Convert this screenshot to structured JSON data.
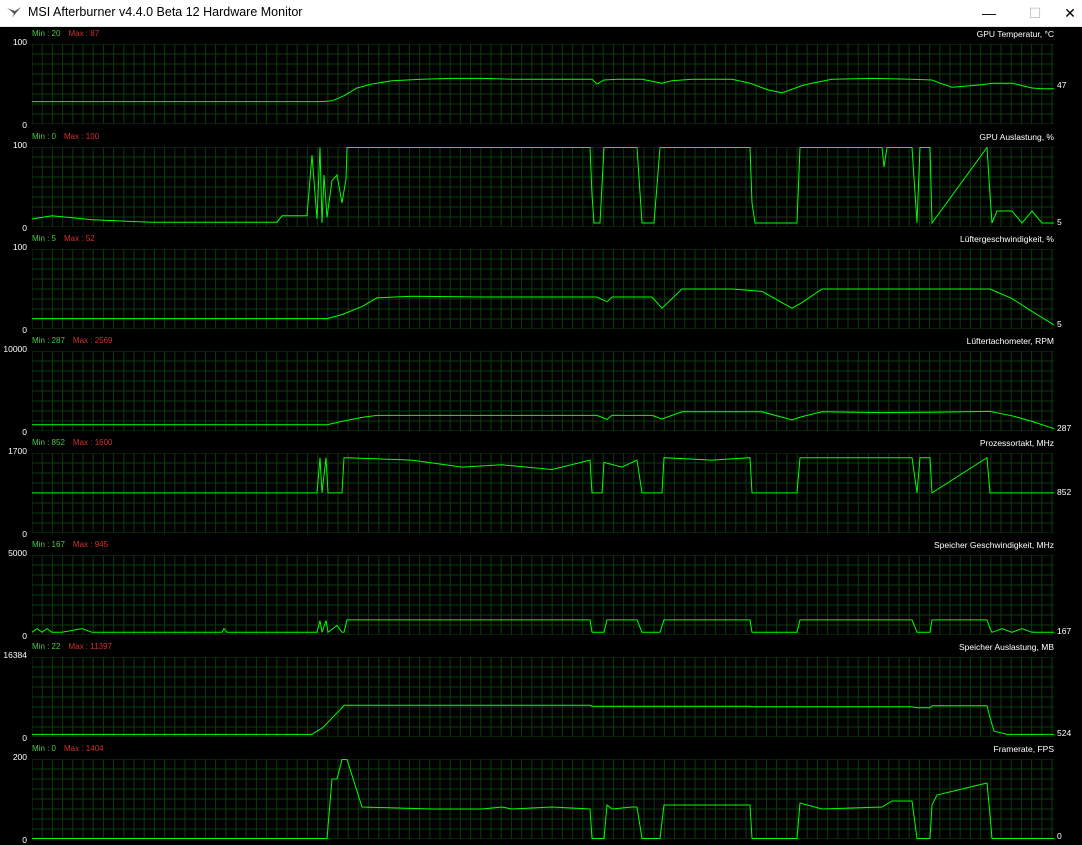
{
  "window": {
    "title": "MSI Afterburner v4.4.0 Beta 12 Hardware Monitor",
    "minimize_glyph": "—",
    "maximize_glyph": "☐",
    "close_glyph": "✕",
    "icon": "afterburner-logo-icon"
  },
  "colors": {
    "background": "#000000",
    "grid": "#0c3a0c",
    "trace": "#00ff00",
    "min_label": "#48c848",
    "max_label": "#d03030",
    "text": "#ffffff"
  },
  "chart_data": [
    {
      "type": "line",
      "title": "GPU Temperatur, °C",
      "min_label": "Min : 20",
      "max_label": "Max : 87",
      "ylim": [
        0,
        100
      ],
      "y_top_label": "100",
      "y_bottom_label": "0",
      "current": "47",
      "grid": true,
      "x": [
        0,
        290,
        300,
        308,
        313,
        325,
        340,
        360,
        390,
        420,
        450,
        480,
        520,
        560,
        565,
        572,
        585,
        610,
        630,
        640,
        660,
        700,
        718,
        735,
        750,
        770,
        780,
        800,
        840,
        880,
        900,
        908,
        920,
        950,
        960,
        980,
        990,
        1000,
        1010,
        1022
      ],
      "values": [
        28,
        28,
        29,
        33,
        36,
        45,
        50,
        54,
        56,
        57,
        57,
        56,
        56,
        56,
        50,
        55,
        56,
        56,
        51,
        54,
        56,
        56,
        51,
        43,
        39,
        48,
        51,
        56,
        57,
        56,
        55,
        51,
        46,
        49,
        51,
        51,
        48,
        45,
        44,
        44
      ]
    },
    {
      "type": "line",
      "title": "GPU Auslastung, %",
      "min_label": "Min : 0",
      "max_label": "Max : 100",
      "ylim": [
        0,
        100
      ],
      "y_top_label": "100",
      "y_bottom_label": "0",
      "current": "5",
      "grid": true,
      "x": [
        0,
        20,
        60,
        120,
        200,
        245,
        250,
        275,
        280,
        285,
        288,
        290,
        292,
        295,
        300,
        305,
        310,
        314,
        315,
        558,
        560,
        562,
        568,
        572,
        575,
        605,
        610,
        622,
        628,
        632,
        718,
        720,
        723,
        758,
        765,
        768,
        850,
        852,
        855,
        880,
        885,
        888,
        898,
        900,
        955,
        958,
        960,
        965,
        980,
        990,
        1000,
        1010,
        1022
      ],
      "values": [
        10,
        14,
        9,
        6,
        6,
        6,
        14,
        14,
        90,
        10,
        100,
        5,
        65,
        12,
        58,
        65,
        30,
        60,
        100,
        100,
        40,
        5,
        5,
        100,
        100,
        100,
        5,
        5,
        100,
        100,
        100,
        30,
        5,
        5,
        5,
        100,
        100,
        75,
        100,
        100,
        5,
        100,
        100,
        5,
        100,
        40,
        5,
        20,
        20,
        5,
        20,
        5,
        5
      ]
    },
    {
      "type": "line",
      "title": "Lüftergeschwindigkeit, %",
      "min_label": "Min : 5",
      "max_label": "Max : 52",
      "ylim": [
        0,
        100
      ],
      "y_top_label": "100",
      "y_bottom_label": "0",
      "current": "5",
      "grid": true,
      "x": [
        0,
        295,
        310,
        330,
        345,
        380,
        450,
        500,
        565,
        575,
        580,
        620,
        630,
        650,
        660,
        700,
        730,
        760,
        770,
        790,
        820,
        850,
        900,
        958,
        980,
        1000,
        1022
      ],
      "values": [
        13,
        13,
        18,
        28,
        39,
        41,
        40,
        40,
        40,
        34,
        40,
        40,
        26,
        50,
        50,
        50,
        47,
        26,
        33,
        50,
        50,
        50,
        50,
        50,
        38,
        22,
        5
      ]
    },
    {
      "type": "line",
      "title": "Lüftertachometer, RPM",
      "min_label": "Min : 287",
      "max_label": "Max : 2569",
      "ylim": [
        0,
        10000
      ],
      "y_top_label": "10000",
      "y_bottom_label": "0",
      "current": "287",
      "grid": true,
      "x": [
        0,
        295,
        310,
        330,
        345,
        450,
        500,
        565,
        575,
        580,
        620,
        630,
        650,
        700,
        730,
        760,
        770,
        790,
        850,
        900,
        958,
        980,
        1000,
        1022
      ],
      "values": [
        780,
        780,
        1200,
        1700,
        1950,
        1950,
        1950,
        1950,
        1450,
        1950,
        1950,
        1500,
        2400,
        2400,
        2400,
        1400,
        1800,
        2400,
        2300,
        2350,
        2450,
        1900,
        1200,
        300
      ]
    },
    {
      "type": "line",
      "title": "Prozessortakt, MHz",
      "min_label": "Min : 852",
      "max_label": "Max : 1600",
      "ylim": [
        0,
        1700
      ],
      "y_top_label": "1700",
      "y_bottom_label": "0",
      "current": "852",
      "grid": true,
      "x": [
        0,
        285,
        288,
        290,
        294,
        296,
        310,
        312,
        315,
        380,
        430,
        470,
        520,
        558,
        560,
        570,
        572,
        590,
        605,
        610,
        630,
        632,
        680,
        718,
        720,
        765,
        768,
        880,
        885,
        888,
        898,
        900,
        955,
        958,
        960,
        1022
      ],
      "values": [
        852,
        852,
        1600,
        852,
        1600,
        852,
        852,
        1600,
        1600,
        1550,
        1400,
        1450,
        1350,
        1550,
        852,
        852,
        1500,
        1400,
        1550,
        852,
        852,
        1600,
        1550,
        1600,
        852,
        852,
        1600,
        1600,
        852,
        1600,
        1600,
        852,
        1600,
        852,
        852,
        852
      ]
    },
    {
      "type": "line",
      "title": "Speicher Geschwindigkeit, MHz",
      "min_label": "Min : 167",
      "max_label": "Max : 945",
      "ylim": [
        0,
        5000
      ],
      "y_top_label": "5000",
      "y_bottom_label": "0",
      "current": "167",
      "grid": true,
      "x": [
        0,
        5,
        10,
        15,
        20,
        30,
        50,
        60,
        80,
        190,
        192,
        195,
        285,
        288,
        290,
        294,
        296,
        305,
        310,
        312,
        315,
        558,
        560,
        572,
        575,
        605,
        610,
        628,
        632,
        718,
        720,
        765,
        768,
        880,
        885,
        898,
        900,
        955,
        958,
        960,
        970,
        980,
        990,
        1000,
        1022
      ],
      "values": [
        167,
        400,
        167,
        400,
        167,
        167,
        400,
        167,
        167,
        167,
        400,
        167,
        167,
        900,
        167,
        900,
        167,
        600,
        167,
        167,
        945,
        945,
        167,
        167,
        945,
        945,
        167,
        167,
        945,
        945,
        167,
        167,
        945,
        945,
        167,
        167,
        945,
        945,
        400,
        167,
        400,
        167,
        400,
        167,
        167
      ]
    },
    {
      "type": "line",
      "title": "Speicher Auslastung, MB",
      "min_label": "Min : 22",
      "max_label": "Max : 11397",
      "ylim": [
        0,
        16384
      ],
      "y_top_label": "16384",
      "y_bottom_label": "0",
      "current": "524",
      "grid": true,
      "x": [
        0,
        280,
        285,
        290,
        295,
        310,
        312,
        558,
        560,
        718,
        720,
        880,
        885,
        898,
        900,
        955,
        958,
        962,
        975,
        1022
      ],
      "values": [
        524,
        524,
        1200,
        1800,
        2800,
        6000,
        6500,
        6500,
        6300,
        6300,
        6200,
        6200,
        6000,
        6000,
        6400,
        6400,
        4000,
        1200,
        524,
        524
      ]
    },
    {
      "type": "line",
      "title": "Framerate, FPS",
      "min_label": "Min : 0",
      "max_label": "Max : 1404",
      "ylim": [
        0,
        200
      ],
      "y_top_label": "200",
      "y_bottom_label": "0",
      "current": "0",
      "grid": true,
      "x": [
        0,
        295,
        300,
        305,
        310,
        315,
        330,
        400,
        450,
        470,
        480,
        520,
        558,
        560,
        572,
        575,
        580,
        600,
        605,
        610,
        628,
        632,
        680,
        718,
        720,
        765,
        768,
        790,
        850,
        860,
        880,
        885,
        898,
        900,
        905,
        955,
        958,
        960,
        1022
      ],
      "values": [
        0,
        0,
        150,
        150,
        200,
        200,
        80,
        75,
        75,
        80,
        75,
        80,
        75,
        0,
        0,
        85,
        75,
        80,
        80,
        0,
        0,
        85,
        85,
        85,
        0,
        0,
        90,
        75,
        80,
        95,
        95,
        0,
        0,
        85,
        110,
        140,
        60,
        0,
        0
      ]
    }
  ]
}
